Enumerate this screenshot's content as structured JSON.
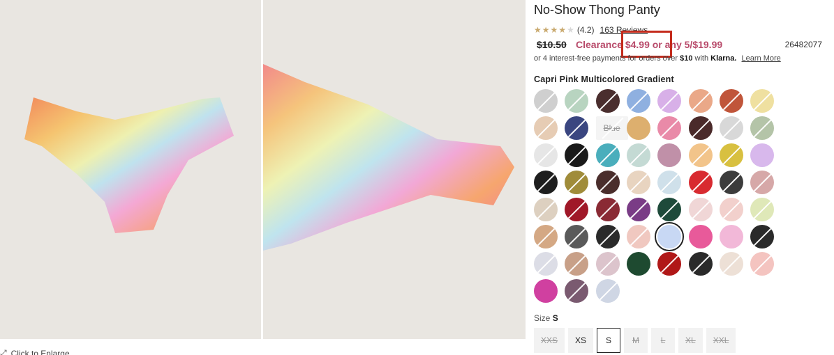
{
  "product": {
    "title": "No-Show Thong Panty",
    "rating_text": "(4.2)",
    "rating_value": 4.2,
    "reviews_label": "163 Reviews",
    "original_price": "$10.50",
    "clearance_text": "Clearance $4.99 or any 5/$19.99",
    "sku": "26482077",
    "klarna_prefix": "or 4 interest-free payments for orders over",
    "klarna_amount": "$10",
    "klarna_with": "with",
    "klarna_brand": "Klarna.",
    "klarna_learn": "Learn More",
    "color_name": "Capri Pink Multicolored Gradient",
    "size_label": "Size",
    "size_selected": "S",
    "enlarge_label": "Click to Enlarge"
  },
  "swatches": [
    {
      "color": "#cfcfcf",
      "na": true
    },
    {
      "color": "#b8d4c0",
      "na": true
    },
    {
      "color": "#4a2e2e",
      "na": true
    },
    {
      "color": "#8fb0e0",
      "na": true
    },
    {
      "color": "#d8b0e8",
      "na": true
    },
    {
      "color": "#eaa888",
      "na": true
    },
    {
      "color": "#c0553a",
      "na": true
    },
    {
      "color": "#efe0a0",
      "na": true
    },
    {
      "color": "#e6ccb4",
      "na": true
    },
    {
      "color": "#3a4680",
      "na": true
    },
    {
      "label": "Blue",
      "na": true
    },
    {
      "color": "#ddaf6e",
      "na": false
    },
    {
      "color": "#e98aa8",
      "na": true
    },
    {
      "color": "#4a2a2a",
      "na": true
    },
    {
      "color": "#d8d8d8",
      "na": true
    },
    {
      "color": "#b4c4a8",
      "na": true
    },
    {
      "color": "#e6e6e6",
      "na": true
    },
    {
      "color": "#1a1a1a",
      "na": true
    },
    {
      "color": "#4aaebc",
      "na": true
    },
    {
      "color": "#c4dad4",
      "na": true
    },
    {
      "color": "#c090a8",
      "na": false
    },
    {
      "color": "#f2c48a",
      "na": true
    },
    {
      "color": "#d8c040",
      "na": true
    },
    {
      "color": "#d8b8ec",
      "na": false
    },
    {
      "color": "#1e1e1e",
      "na": true
    },
    {
      "color": "#a08c3a",
      "na": true
    },
    {
      "color": "#4a2e2c",
      "na": true
    },
    {
      "color": "#e8d4c0",
      "na": true
    },
    {
      "color": "#cfe0ea",
      "na": true
    },
    {
      "color": "#d82a30",
      "na": true
    },
    {
      "color": "#3c3c3c",
      "na": true
    },
    {
      "color": "#d6a8a8",
      "na": true
    },
    {
      "color": "#ddd0c0",
      "na": true
    },
    {
      "color": "#a01828",
      "na": true
    },
    {
      "color": "#8a2a34",
      "na": true
    },
    {
      "color": "#7a3c86",
      "na": true
    },
    {
      "color": "#1e4a3a",
      "na": true
    },
    {
      "color": "#f0d6d6",
      "na": true
    },
    {
      "color": "#f2d0cc",
      "na": true
    },
    {
      "color": "#dfe8b8",
      "na": true
    },
    {
      "color": "#d4a884",
      "na": true
    },
    {
      "color": "#5a5a5a",
      "na": true
    },
    {
      "color": "#2a2a2a",
      "na": true
    },
    {
      "color": "#f0c8c0",
      "na": true
    },
    {
      "color": "#c8d8f4",
      "na": false,
      "selected": true
    },
    {
      "color": "#e85a9a",
      "na": false
    },
    {
      "color": "#f2b8d8",
      "na": false
    },
    {
      "color": "#2a2a2a",
      "na": true
    },
    {
      "color": "#dcdde6",
      "na": true
    },
    {
      "color": "#c8a088",
      "na": true
    },
    {
      "color": "#dcc4cc",
      "na": true
    },
    {
      "color": "#1e4a30",
      "na": false
    },
    {
      "color": "#b01818",
      "na": true
    },
    {
      "color": "#2a2a2a",
      "na": true
    },
    {
      "color": "#ede0d6",
      "na": true
    },
    {
      "color": "#f4c4c0",
      "na": true
    },
    {
      "color": "#d040a0",
      "na": false
    },
    {
      "color": "#7a5a70",
      "na": true
    },
    {
      "color": "#cfd6e4",
      "na": true
    }
  ],
  "sizes": [
    {
      "label": "XXS",
      "state": "na"
    },
    {
      "label": "XS",
      "state": "avail"
    },
    {
      "label": "S",
      "state": "sel"
    },
    {
      "label": "M",
      "state": "na"
    },
    {
      "label": "L",
      "state": "na"
    },
    {
      "label": "XL",
      "state": "na"
    },
    {
      "label": "XXL",
      "state": "na"
    }
  ]
}
